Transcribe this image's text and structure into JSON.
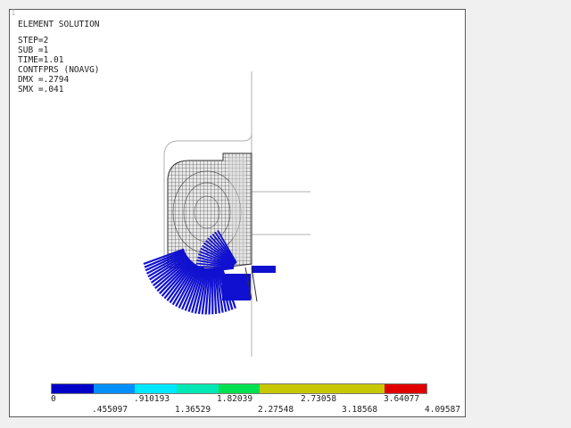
{
  "window_number": "1",
  "header": {
    "title": "ELEMENT SOLUTION",
    "lines": [
      "STEP=2",
      "SUB =1",
      "TIME=1.01",
      "CONTFPRS (NOAVG)",
      "DMX =.2794",
      "SMX =.041"
    ]
  },
  "legend": {
    "colors": [
      "#0000c8",
      "#0090ff",
      "#00e8ff",
      "#00e8b4",
      "#00e050",
      "#c8c800",
      "#c8c800",
      "#c8c800",
      "#e00000"
    ],
    "top_labels": [
      "0",
      ".910193",
      "1.82039",
      "2.73058",
      "3.64077"
    ],
    "bottom_labels": [
      ".455097",
      "1.36529",
      "2.27548",
      "3.18568",
      "4.09587"
    ]
  },
  "colors": {
    "mesh_line": "#303030",
    "pressure": "#1010d0",
    "guide": "#b0b0b0"
  }
}
